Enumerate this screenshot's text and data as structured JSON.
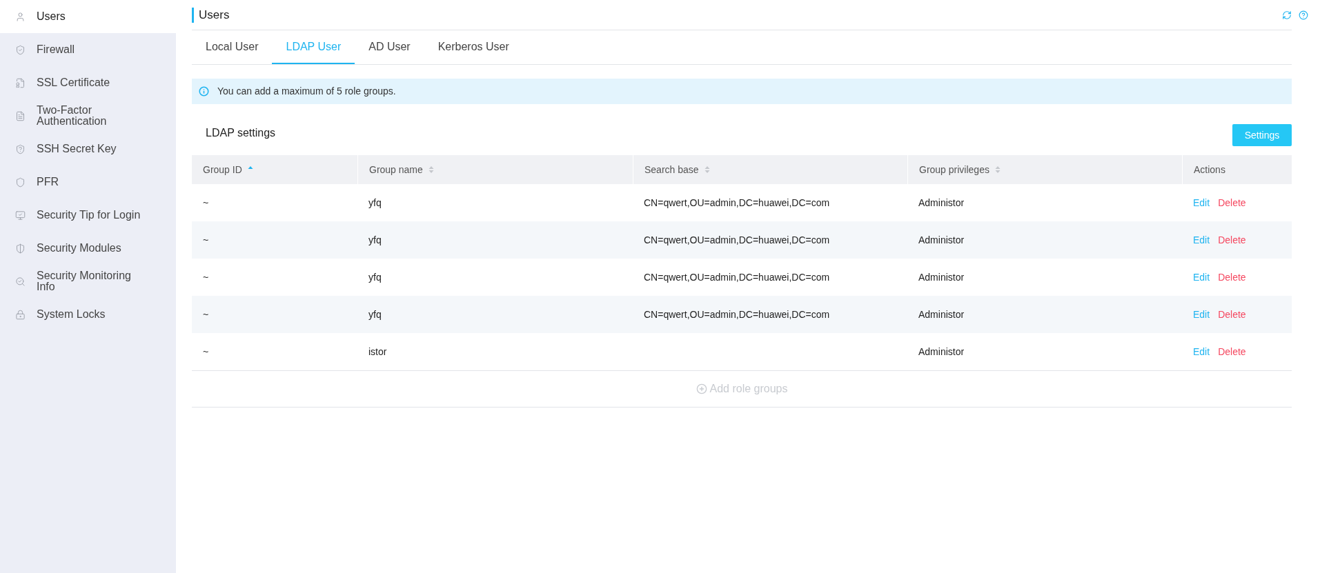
{
  "sidebar": {
    "items": [
      {
        "label": "Users",
        "selected": true
      },
      {
        "label": "Firewall",
        "selected": false
      },
      {
        "label": "SSL Certificate",
        "selected": false
      },
      {
        "label": "Two-Factor Authentication",
        "selected": false
      },
      {
        "label": "SSH Secret Key",
        "selected": false
      },
      {
        "label": "PFR",
        "selected": false
      },
      {
        "label": "Security Tip for Login",
        "selected": false
      },
      {
        "label": "Security Modules",
        "selected": false
      },
      {
        "label": "Security Monitoring Info",
        "selected": false
      },
      {
        "label": "System Locks",
        "selected": false
      }
    ]
  },
  "page": {
    "title": "Users"
  },
  "tabs": [
    {
      "label": "Local User",
      "selected": false
    },
    {
      "label": "LDAP User",
      "selected": true
    },
    {
      "label": "AD User",
      "selected": false
    },
    {
      "label": "Kerberos User",
      "selected": false
    }
  ],
  "notice": "You can add a maximum of 5 role groups.",
  "section": {
    "title": "LDAP settings",
    "button": "Settings"
  },
  "table": {
    "columns": [
      {
        "label": "Group ID",
        "sorted": true
      },
      {
        "label": "Group name",
        "sorted": false
      },
      {
        "label": "Search base",
        "sorted": false
      },
      {
        "label": "Group privileges",
        "sorted": false
      },
      {
        "label": "Actions"
      }
    ],
    "rows": [
      {
        "cells": [
          "~",
          "yfq",
          "CN=qwert,OU=admin,DC=huawei,DC=com",
          "Administor"
        ],
        "actions": [
          "Edit",
          "Delete"
        ]
      },
      {
        "cells": [
          "~",
          "yfq",
          "CN=qwert,OU=admin,DC=huawei,DC=com",
          "Administor"
        ],
        "actions": [
          "Edit",
          "Delete"
        ]
      },
      {
        "cells": [
          "~",
          "yfq",
          "CN=qwert,OU=admin,DC=huawei,DC=com",
          "Administor"
        ],
        "actions": [
          "Edit",
          "Delete"
        ]
      },
      {
        "cells": [
          "~",
          "yfq",
          "CN=qwert,OU=admin,DC=huawei,DC=com",
          "Administor"
        ],
        "actions": [
          "Edit",
          "Delete"
        ]
      },
      {
        "cells": [
          "~",
          "istor",
          "",
          "Administor"
        ],
        "actions": [
          "Edit",
          "Delete"
        ]
      }
    ],
    "add_button": {
      "label": "Add role groups",
      "disabled": true
    }
  }
}
